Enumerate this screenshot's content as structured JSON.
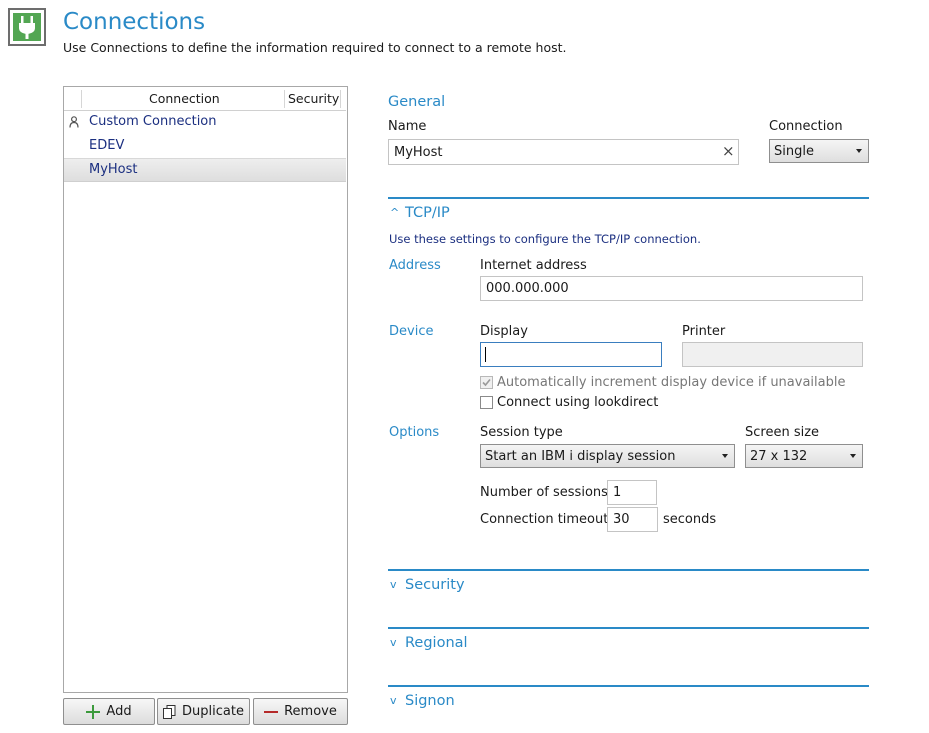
{
  "header": {
    "title": "Connections",
    "subtitle": "Use Connections to define the information required to connect to a remote host."
  },
  "list": {
    "columns": [
      "Connection",
      "Security"
    ],
    "rows": [
      {
        "label": "Custom Connection",
        "icon": "user-icon"
      },
      {
        "label": "EDEV"
      },
      {
        "label": "MyHost",
        "selected": true
      }
    ]
  },
  "buttons": {
    "add": "Add",
    "duplicate": "Duplicate",
    "remove": "Remove"
  },
  "general": {
    "heading": "General",
    "name_label": "Name",
    "name_value": "MyHost",
    "clear_glyph": "×",
    "connection_label": "Connection",
    "connection_value": "Single"
  },
  "tcpip": {
    "heading": "TCP/IP",
    "description": "Use these settings to configure the TCP/IP connection.",
    "address_group": "Address",
    "internet_address_label": "Internet address",
    "internet_address_value": "000.000.000",
    "device_group": "Device",
    "display_label": "Display",
    "display_value": "",
    "printer_label": "Printer",
    "printer_value": "",
    "auto_increment_label": "Automatically increment display device if unavailable",
    "auto_increment_checked": true,
    "lookdirect_label": "Connect using lookdirect",
    "lookdirect_checked": false,
    "options_group": "Options",
    "session_type_label": "Session type",
    "session_type_value": "Start an IBM i display session",
    "screen_size_label": "Screen size",
    "screen_size_value": "27 x 132",
    "num_sessions_label": "Number of sessions",
    "num_sessions_value": "1",
    "timeout_label": "Connection timeout",
    "timeout_value": "30",
    "timeout_unit": "seconds"
  },
  "collapsed_sections": {
    "security": "Security",
    "regional": "Regional",
    "signon": "Signon"
  },
  "colors": {
    "accent": "#2a8ac7",
    "icon_green": "#53a653",
    "list_text": "#1b2f80"
  }
}
